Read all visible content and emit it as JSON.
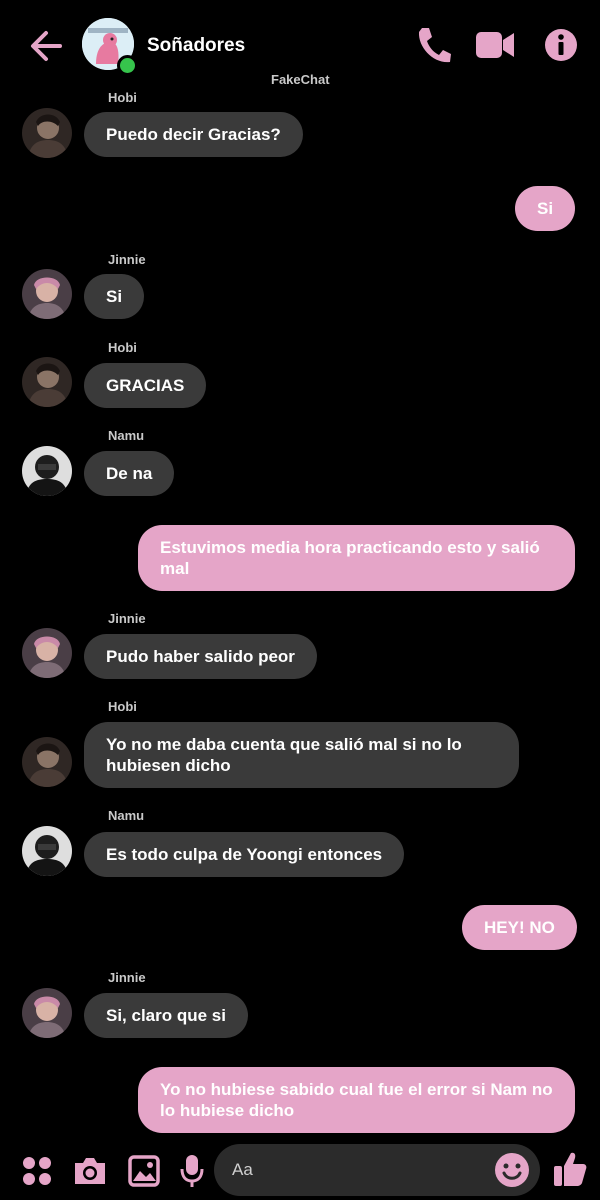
{
  "header": {
    "title": "Soñadores",
    "watermark": "FakeChat"
  },
  "colors": {
    "accent": "#e5a5c8",
    "incoming_bubble": "#3a3a3a",
    "online": "#36c44c"
  },
  "messages": [
    {
      "sender": "Hobi",
      "text": "Puedo decir Gracias?"
    },
    {
      "sender": "",
      "text": "Si"
    },
    {
      "sender": "Jinnie",
      "text": "Si"
    },
    {
      "sender": "Hobi",
      "text": "GRACIAS"
    },
    {
      "sender": "Namu",
      "text": "De na"
    },
    {
      "sender": "",
      "text": "Estuvimos media hora practicando esto y salió mal"
    },
    {
      "sender": "Jinnie",
      "text": "Pudo haber salido peor"
    },
    {
      "sender": "Hobi",
      "text": "Yo no me daba cuenta que salió mal si no lo hubiesen dicho"
    },
    {
      "sender": "Namu",
      "text": "Es todo culpa de Yoongi entonces"
    },
    {
      "sender": "",
      "text": "HEY! NO"
    },
    {
      "sender": "Jinnie",
      "text": "Si, claro que si"
    },
    {
      "sender": "",
      "text": "Yo no hubiese sabido cual fue el error si Nam no lo hubiese dicho"
    }
  ],
  "composer": {
    "placeholder": "Aa"
  },
  "icons": {
    "back": "arrow-left-icon",
    "call": "phone-icon",
    "video": "video-camera-icon",
    "info": "info-icon",
    "apps": "four-dots-icon",
    "camera": "camera-icon",
    "gallery": "image-icon",
    "mic": "microphone-icon",
    "emoji": "smiley-icon",
    "like": "thumbs-up-icon"
  }
}
